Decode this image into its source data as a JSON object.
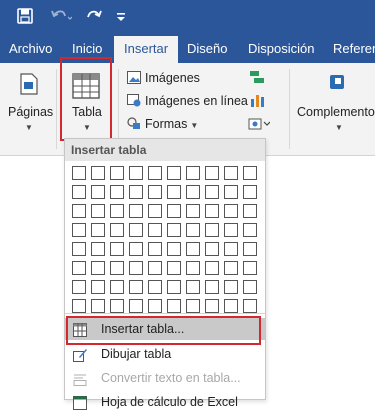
{
  "quick_access": {
    "icons": [
      "save-icon",
      "undo-icon",
      "redo-icon",
      "customize-quick-access-icon"
    ]
  },
  "tabs": [
    "Archivo",
    "Inicio",
    "Insertar",
    "Diseño",
    "Disposición",
    "Referencias"
  ],
  "active_tab": "Insertar",
  "ribbon": {
    "paginas": "Páginas",
    "tabla": "Tabla",
    "imagenes": "Imágenes",
    "imagenes_en_linea": "Imágenes en línea",
    "formas": "Formas",
    "complementos": "Complementos"
  },
  "dropdown": {
    "header": "Insertar tabla",
    "grid_columns": 10,
    "grid_rows": 8,
    "items": [
      {
        "label": "Insertar tabla...",
        "highlighted": true,
        "enabled": true
      },
      {
        "label": "Dibujar tabla",
        "highlighted": false,
        "enabled": true
      },
      {
        "label": "Convertir texto en tabla...",
        "highlighted": false,
        "enabled": false
      },
      {
        "label": "Hoja de cálculo de Excel",
        "highlighted": false,
        "enabled": true
      }
    ]
  },
  "colors": {
    "title_bar": "#2b579a",
    "ribbon_bg": "#f3f3f3",
    "highlight_box": "#d3282e",
    "menu_highlight": "#c9c9c9"
  }
}
